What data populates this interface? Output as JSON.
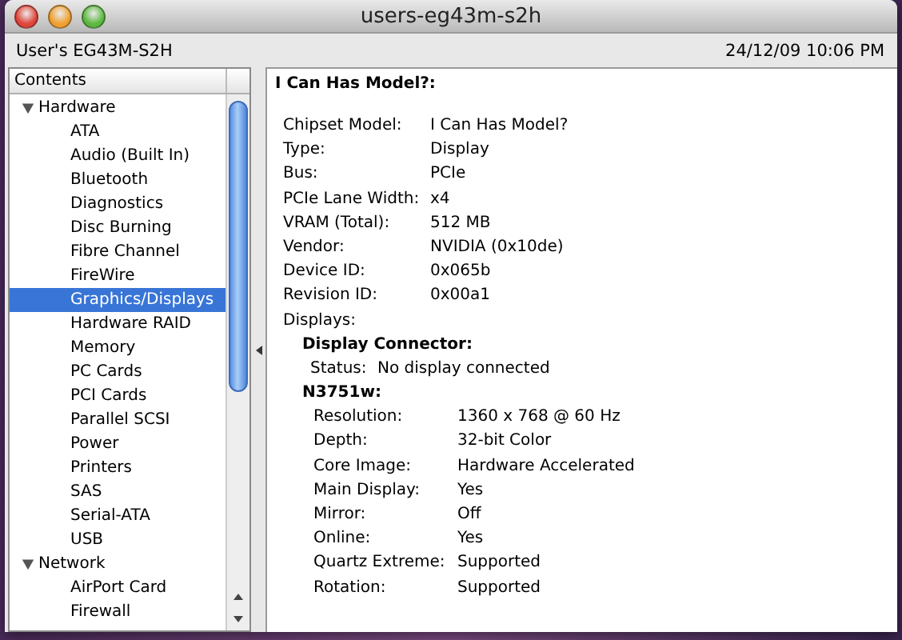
{
  "window": {
    "title": "users-eg43m-s2h"
  },
  "toolbar": {
    "computer_name": "User's EG43M-S2H",
    "date": "24/12/09 10:06 PM"
  },
  "sidebar": {
    "header": "Contents",
    "tree": [
      {
        "label": "Hardware",
        "expanded": true,
        "selected": false,
        "children": [
          {
            "label": "ATA",
            "selected": false
          },
          {
            "label": "Audio (Built In)",
            "selected": false
          },
          {
            "label": "Bluetooth",
            "selected": false
          },
          {
            "label": "Diagnostics",
            "selected": false
          },
          {
            "label": "Disc Burning",
            "selected": false
          },
          {
            "label": "Fibre Channel",
            "selected": false
          },
          {
            "label": "FireWire",
            "selected": false
          },
          {
            "label": "Graphics/Displays",
            "selected": true
          },
          {
            "label": "Hardware RAID",
            "selected": false
          },
          {
            "label": "Memory",
            "selected": false
          },
          {
            "label": "PC Cards",
            "selected": false
          },
          {
            "label": "PCI Cards",
            "selected": false
          },
          {
            "label": "Parallel SCSI",
            "selected": false
          },
          {
            "label": "Power",
            "selected": false
          },
          {
            "label": "Printers",
            "selected": false
          },
          {
            "label": "SAS",
            "selected": false
          },
          {
            "label": "Serial-ATA",
            "selected": false
          },
          {
            "label": "USB",
            "selected": false
          }
        ]
      },
      {
        "label": "Network",
        "expanded": true,
        "selected": false,
        "children": [
          {
            "label": "AirPort Card",
            "selected": false
          },
          {
            "label": "Firewall",
            "selected": false
          }
        ]
      }
    ]
  },
  "detail": {
    "title": "I Can Has Model?:",
    "properties": [
      {
        "label": "Chipset Model:",
        "value": "I Can Has Model?"
      },
      {
        "label": "Type:",
        "value": "Display"
      },
      {
        "label": "Bus:",
        "value": "PCIe"
      },
      {
        "label": "PCIe Lane Width:",
        "value": "x4"
      },
      {
        "label": "VRAM (Total):",
        "value": "512 MB"
      },
      {
        "label": "Vendor:",
        "value": "NVIDIA (0x10de)"
      },
      {
        "label": "Device ID:",
        "value": "0x065b"
      },
      {
        "label": "Revision ID:",
        "value": "0x00a1"
      }
    ],
    "displays_label": "Displays:",
    "displays": [
      {
        "name": "Display Connector:",
        "properties": [
          {
            "label": "Status:",
            "value": "No display connected"
          }
        ]
      },
      {
        "name": "N3751w:",
        "properties": [
          {
            "label": "Resolution:",
            "value": "1360 x 768 @ 60 Hz"
          },
          {
            "label": "Depth:",
            "value": "32-bit Color"
          },
          {
            "label": "Core Image:",
            "value": "Hardware Accelerated"
          },
          {
            "label": "Main Display:",
            "value": "Yes"
          },
          {
            "label": "Mirror:",
            "value": "Off"
          },
          {
            "label": "Online:",
            "value": "Yes"
          },
          {
            "label": "Quartz Extreme:",
            "value": "Supported"
          },
          {
            "label": "Rotation:",
            "value": "Supported"
          }
        ]
      }
    ]
  }
}
